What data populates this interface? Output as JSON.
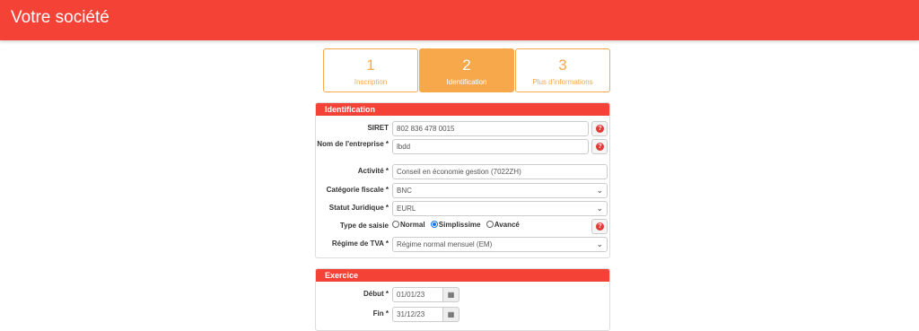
{
  "header": {
    "title": "Votre société"
  },
  "steps": [
    {
      "num": "1",
      "label": "Inscription"
    },
    {
      "num": "2",
      "label": "Identification"
    },
    {
      "num": "3",
      "label": "Plus d'informations"
    }
  ],
  "identification": {
    "title": "Identification",
    "siret": {
      "label": "SIRET",
      "value": "802 836 478 0015"
    },
    "nom": {
      "label": "Nom de l'entreprise *",
      "value": "lbdd"
    },
    "activite": {
      "label": "Activité *",
      "value": "Conseil en économie gestion (7022ZH)"
    },
    "categorie": {
      "label": "Catégorie fiscale *",
      "value": "BNC"
    },
    "statut": {
      "label": "Statut Juridique *",
      "value": "EURL"
    },
    "type_saisie": {
      "label": "Type de saisie",
      "options": [
        "Normal",
        "Simplissime",
        "Avancé"
      ],
      "selected": "Simplissime"
    },
    "regime": {
      "label": "Régime de TVA *",
      "value": "Régime normal mensuel (EM)"
    }
  },
  "exercice": {
    "title": "Exercice",
    "debut": {
      "label": "Début *",
      "value": "01/01/23"
    },
    "fin": {
      "label": "Fin *",
      "value": "31/12/23"
    }
  },
  "icons": {
    "help": "?",
    "calendar": "▦",
    "chevron": "⌄"
  },
  "colors": {
    "header": "#f44336",
    "step_accent": "#f7a84a",
    "help_dot": "#e53935"
  }
}
